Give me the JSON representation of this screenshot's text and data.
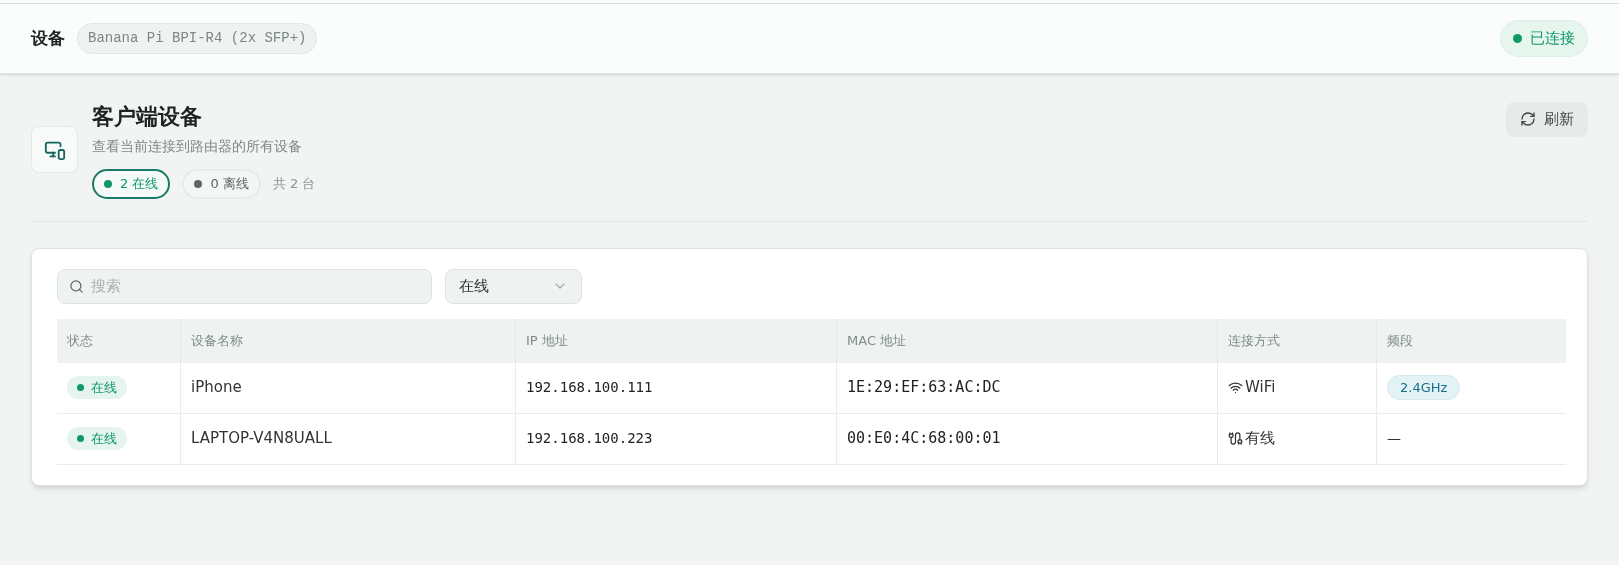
{
  "header": {
    "title": "设备",
    "device": "Banana Pi BPI-R4 (2x SFP+)",
    "status": {
      "label": "已连接",
      "connected": true
    }
  },
  "section": {
    "title": "客户端设备",
    "subtitle": "查看当前连接到路由器的所有设备",
    "refresh": "刷新",
    "filters": [
      {
        "label": "2 在线",
        "selected": true,
        "color": "#0f9968"
      },
      {
        "label": "0 离线",
        "selected": false,
        "color": "#5c6663"
      }
    ],
    "total": "共 2 台"
  },
  "toolbar": {
    "search": {
      "placeholder": "搜索"
    },
    "filter": {
      "value": "在线"
    }
  },
  "table": {
    "columns": [
      "状态",
      "设备名称",
      "IP 地址",
      "MAC 地址",
      "连接方式",
      "频段"
    ],
    "rows": [
      {
        "status": "在线",
        "online": true,
        "name": "iPhone",
        "ip": "192.168.100.111",
        "mac": "1E:29:EF:63:AC:DC",
        "connection": {
          "kind": "wifi",
          "label": "WiFi"
        },
        "band": {
          "kind": "badge",
          "label": "2.4GHz"
        }
      },
      {
        "status": "在线",
        "online": true,
        "name": "LAPTOP-V4N8UALL",
        "ip": "192.168.100.223",
        "mac": "00:E0:4C:68:00:01",
        "connection": {
          "kind": "wired",
          "label": "有线"
        },
        "band": {
          "kind": "plain",
          "label": "—"
        }
      }
    ]
  }
}
